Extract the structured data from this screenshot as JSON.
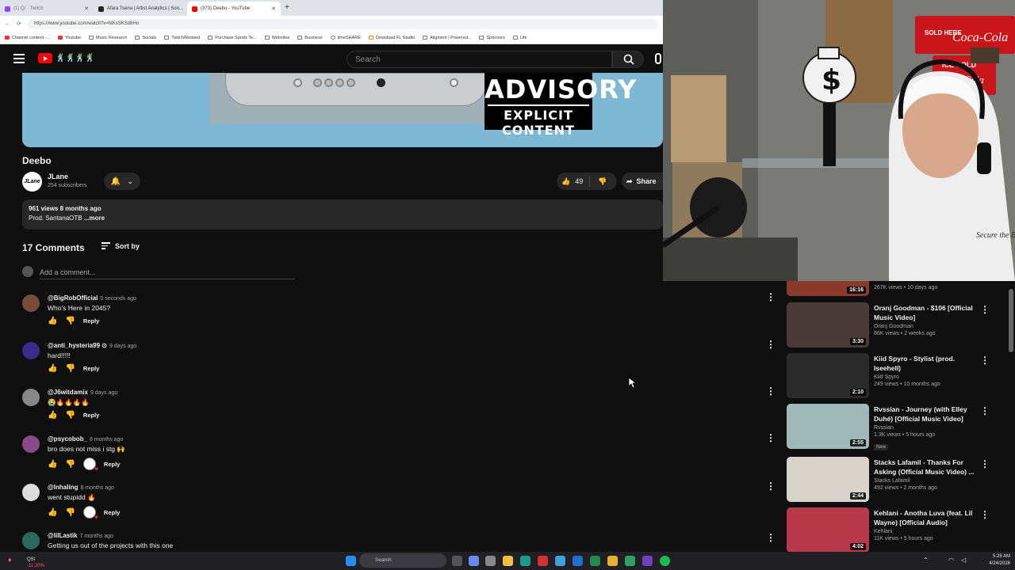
{
  "browser": {
    "tabs": [
      {
        "label": "(1) Q/ · Twitch",
        "color": "#9147ff"
      },
      {
        "label": "Afara Tsena | Artist Analytics | Son...",
        "color": "#222222"
      },
      {
        "label": "(373) Deebo - YouTube",
        "color": "#ff0000"
      }
    ],
    "url": "https://www.youtube.com/watch?v=htKsSKSd8Ho",
    "bookmarks": [
      "Channel content -...",
      "Youtube",
      "Music Research",
      "Socials",
      "Twitch/Related",
      "Purchase Sports Te...",
      "Websites",
      "Business",
      "timeSHARE",
      "Download FL Studio",
      "Aligment | Powered...",
      "Sponsors",
      "Life"
    ]
  },
  "youtube": {
    "search_placeholder": "Search",
    "video": {
      "advisory_line1": "ADVISORY",
      "advisory_line2": "EXPLICIT CONTENT",
      "title": "Deebo",
      "channel": "JLane",
      "channel_avatar_text": "JLane",
      "subscribers": "254 subscribers",
      "likes": "49",
      "share_label": "Share",
      "views_age": "961 views  8 months ago",
      "description": "Prod. SantanaOTB",
      "more": "...more"
    },
    "comments_header": "17 Comments",
    "sort_label": "Sort by",
    "add_comment_placeholder": "Add a comment...",
    "reply_label": "Reply",
    "comments": [
      {
        "handle": "@BigRobOfficial",
        "time": "0 seconds ago",
        "text": "Who's Here in 2045?",
        "avatar_color": "#7a4a3a",
        "hearted": false
      },
      {
        "handle": "@anti_hysteria99",
        "time": "9 days ago",
        "text": "hard!!!!!",
        "avatar_color": "#3a2a8a",
        "hearted": false,
        "verified_mark": "⊙"
      },
      {
        "handle": "@J6witdamix",
        "time": "9 days ago",
        "text": "😭🔥🔥🔥🔥",
        "avatar_color": "#888888",
        "hearted": false
      },
      {
        "handle": "@psycobob_",
        "time": "8 months ago",
        "text": "bro does not miss i stg 🙌",
        "avatar_color": "#8a4a8a",
        "hearted": true
      },
      {
        "handle": "@lnhaling",
        "time": "8 months ago",
        "text": "went stupidd 🔥",
        "avatar_color": "#dddddd",
        "hearted": true
      },
      {
        "handle": "@lilLastik",
        "time": "7 months ago",
        "text": "Getting us out of the projects with this one",
        "avatar_color": "#2a6a5a",
        "hearted": false
      }
    ],
    "recommendations": [
      {
        "title": "",
        "channel": "",
        "stats": "267K views • 10 days ago",
        "duration": "16:16",
        "thumb": "#8a3a2a",
        "badge": ""
      },
      {
        "title": "Oranj Goodman - $106 [Official Music Video]",
        "channel": "Oranj Goodman",
        "stats": "86K views • 2 weeks ago",
        "duration": "3:30",
        "thumb": "#4a3a3a",
        "badge": ""
      },
      {
        "title": "Kiid Spyro - Stylist (prod. Iseehell)",
        "channel": "Kiid Spyro",
        "stats": "249 views • 10 months ago",
        "duration": "2:10",
        "thumb": "#2a2a2a",
        "badge": ""
      },
      {
        "title": "Rvssian - Journey (with Elley Duhé) [Official Music Video]",
        "channel": "Rvssian",
        "stats": "1.3K views • 5 hours ago",
        "duration": "2:55",
        "thumb": "#9fb8b8",
        "badge": "New"
      },
      {
        "title": "Stacks Lafamil - Thanks For Asking (Official Music Video) ...",
        "channel": "Stacks Lafamil",
        "stats": "492 views • 2 months ago",
        "duration": "2:44",
        "thumb": "#d8d4cc",
        "badge": ""
      },
      {
        "title": "Kehlani - Anotha Luva (feat. Lil Wayne) [Official Audio]",
        "channel": "Kehlani",
        "stats": "11K views • 5 hours ago",
        "duration": "4:02",
        "thumb": "#b83a4a",
        "badge": ""
      }
    ]
  },
  "webcam": {
    "sign_text1": "SOLD HERE",
    "sign_text2": "Coca-Cola",
    "sign_text3": "ICE COLD",
    "sign_text4": "Coca-Cola",
    "bag_symbol": "$",
    "shirt_text": "Secure the Bag"
  },
  "taskbar": {
    "stock_name": "QSI",
    "stock_change": "-11.20%",
    "search_label": "Search",
    "time": "5:28 AM",
    "date": "4/24/2026"
  }
}
